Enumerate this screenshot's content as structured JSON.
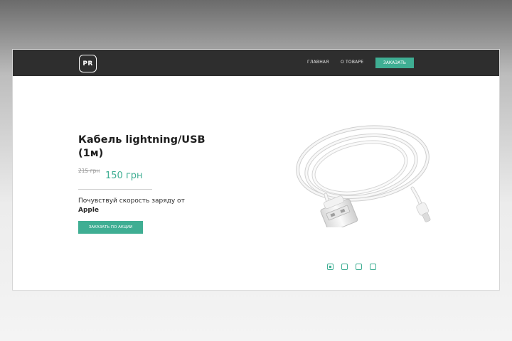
{
  "header": {
    "logo_text": "PR",
    "nav": {
      "home": "ГЛАВНАЯ",
      "about": "О ТОВАРЕ",
      "order": "ЗАКАЗАТЬ"
    }
  },
  "hero": {
    "title": "Кабель lightning/USB (1м)",
    "old_price": "215 грн",
    "new_price": "150 грн",
    "tagline_prefix": "Почувствуй скорость заряду от",
    "tagline_brand": "Apple",
    "cta_label": "ЗАКАЗАТЬ ПО АКЦИИ"
  },
  "product_image": {
    "icon": "lightning-usb-cable"
  },
  "carousel": {
    "slides": 4,
    "active_index": 0
  },
  "colors": {
    "accent": "#3fae93",
    "header_bg": "#2e2e2e"
  }
}
